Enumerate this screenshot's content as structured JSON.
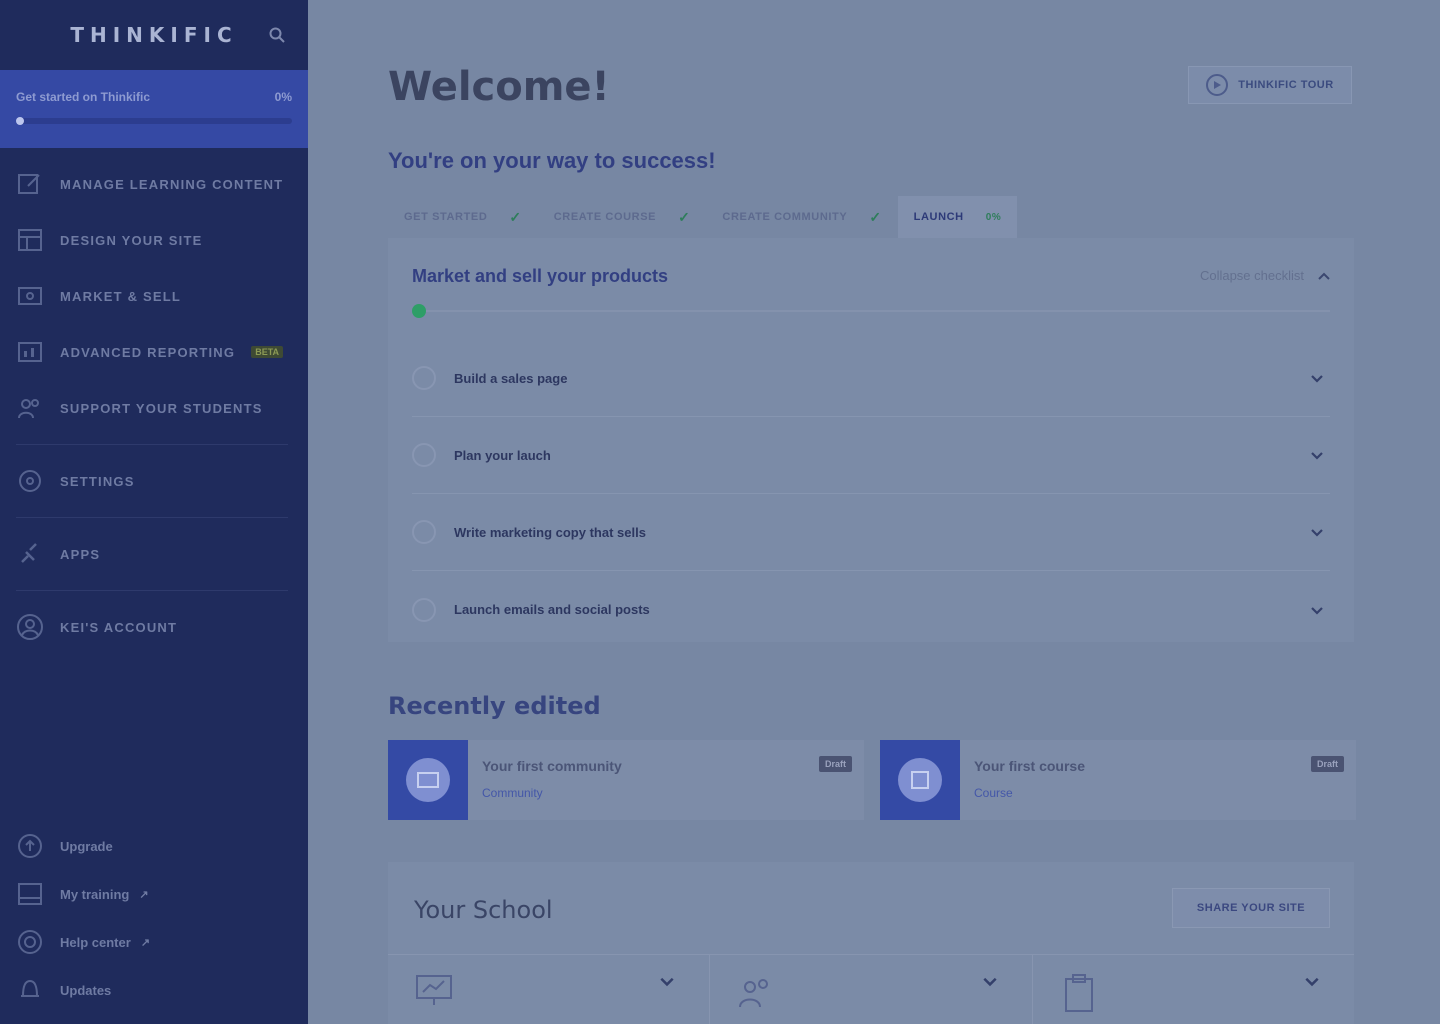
{
  "sidebar": {
    "brand": "THINKIFIC",
    "get_started": {
      "label": "Get started on Thinkific",
      "percent": "0%",
      "progress": 0
    },
    "items": [
      {
        "label": "MANAGE LEARNING CONTENT",
        "icon": "edit-icon"
      },
      {
        "label": "DESIGN YOUR SITE",
        "icon": "layout-icon"
      },
      {
        "label": "MARKET & SELL",
        "icon": "tag-icon"
      },
      {
        "label": "ADVANCED REPORTING",
        "icon": "chart-icon",
        "badge": "BETA"
      },
      {
        "label": "SUPPORT YOUR STUDENTS",
        "icon": "users-icon"
      },
      {
        "label": "SETTINGS",
        "icon": "gear-icon"
      },
      {
        "label": "APPS",
        "icon": "plug-icon"
      },
      {
        "label": "KEI'S ACCOUNT",
        "icon": "user-circle-icon"
      }
    ],
    "bottom": [
      {
        "label": "Upgrade",
        "icon": "upgrade-icon"
      },
      {
        "label": "My training",
        "icon": "training-icon",
        "ext": "↗"
      },
      {
        "label": "Help center",
        "icon": "help-icon",
        "ext": "↗"
      },
      {
        "label": "Updates",
        "icon": "bell-icon"
      }
    ]
  },
  "main": {
    "title": "Welcome!",
    "tour_label": "THINKIFIC TOUR",
    "subtitle": "You're on your way to success!",
    "tabs": [
      {
        "label": "GET STARTED",
        "check": "✓"
      },
      {
        "label": "CREATE COURSE",
        "check": "✓"
      },
      {
        "label": "CREATE COMMUNITY",
        "check": "✓"
      },
      {
        "label": "LAUNCH",
        "pct": "0%"
      }
    ],
    "checklist": {
      "title": "Market and sell your products",
      "collapse_label": "Collapse checklist",
      "progress": 0,
      "items": [
        "Build a sales page",
        "Plan your lauch",
        "Write marketing copy that sells",
        "Launch emails and social posts"
      ]
    },
    "recent": {
      "title": "Recently edited",
      "cards": [
        {
          "title": "Your first community",
          "sub": "Community",
          "badge": "Draft"
        },
        {
          "title": "Your first course",
          "sub": "Course",
          "badge": "Draft"
        }
      ]
    },
    "school": {
      "title": "Your School",
      "share_label": "SHARE YOUR SITE"
    }
  }
}
